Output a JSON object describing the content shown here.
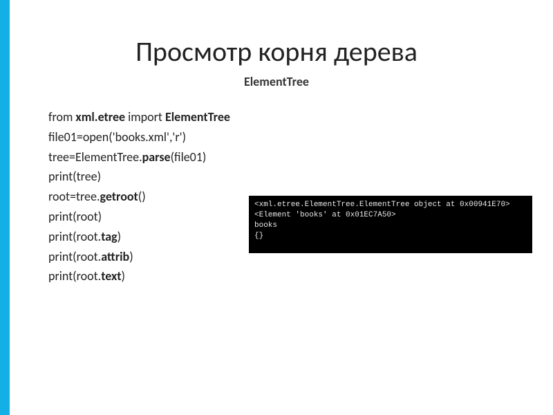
{
  "title": "Просмотр корня дерева",
  "subtitle": "ElementTree",
  "code": {
    "l1a": "from ",
    "l1b": "xml.etree",
    "l1c": " import ",
    "l1d": "ElementTree",
    "l2": "file01=open('books.xml','r')",
    "l3a": "tree=ElementTree.",
    "l3b": "parse",
    "l3c": "(file01)",
    "l4": "print(tree)",
    "l5a": "root=tree.",
    "l5b": "getroot",
    "l5c": "()",
    "l6": "print(root)",
    "l7a": "print(root.",
    "l7b": "tag",
    "l7c": ")",
    "l8a": "print(root.",
    "l8b": "attrib",
    "l8c": ")",
    "l9a": "print(root.",
    "l9b": "text",
    "l9c": ")"
  },
  "console": {
    "r1": "<xml.etree.ElementTree.ElementTree object at 0x00941E70>",
    "r2": "<Element 'books' at 0x01EC7A50>",
    "r3": "books",
    "r4": "{}"
  }
}
